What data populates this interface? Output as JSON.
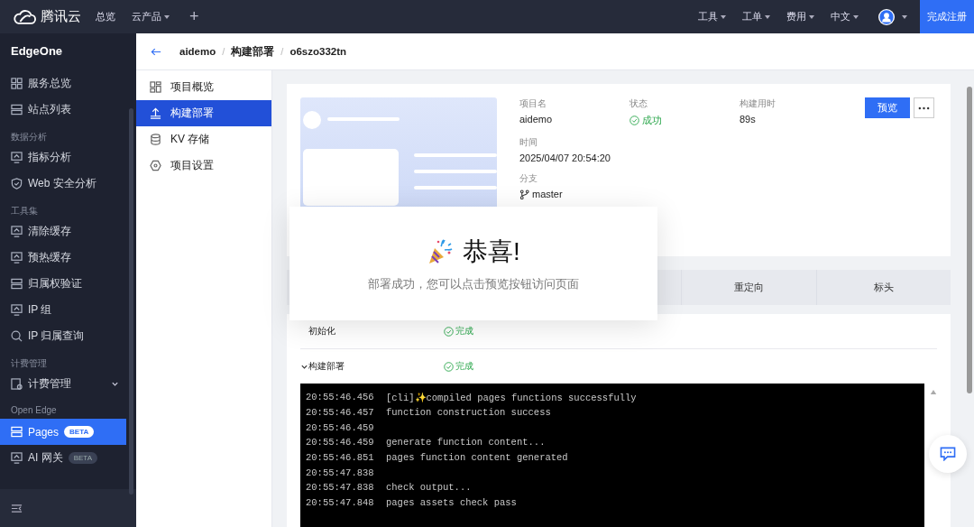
{
  "topbar": {
    "brand": "腾讯云",
    "nav": [
      {
        "label": "总览",
        "dropdown": false
      },
      {
        "label": "云产品",
        "dropdown": true
      }
    ],
    "add": "+",
    "menus": [
      {
        "label": "工具"
      },
      {
        "label": "工单"
      },
      {
        "label": "费用"
      },
      {
        "label": "中文"
      }
    ],
    "register": "完成注册"
  },
  "sidebar": {
    "title": "EdgeOne",
    "groups": [
      {
        "items": [
          {
            "label": "服务总览",
            "selected": false
          },
          {
            "label": "站点列表",
            "selected": false
          }
        ]
      },
      {
        "heading": "数据分析",
        "items": [
          {
            "label": "指标分析",
            "selected": false
          },
          {
            "label": "Web 安全分析",
            "selected": false
          }
        ]
      },
      {
        "heading": "工具集",
        "items": [
          {
            "label": "清除缓存",
            "selected": false
          },
          {
            "label": "预热缓存",
            "selected": false
          },
          {
            "label": "归属权验证",
            "selected": false
          },
          {
            "label": "IP 组",
            "selected": false
          },
          {
            "label": "IP 归属查询",
            "selected": false
          }
        ]
      },
      {
        "heading": "计费管理",
        "items": [
          {
            "label": "计费管理",
            "selected": false,
            "expandable": true
          }
        ]
      },
      {
        "heading": "Open Edge",
        "items": [
          {
            "label": "Pages",
            "selected": true,
            "badge": "BETA"
          },
          {
            "label": "AI 网关",
            "selected": false,
            "badge": "BETA"
          }
        ]
      }
    ]
  },
  "breadcrumb": {
    "separator": "/",
    "items": [
      "aidemo",
      "构建部署",
      "o6szo332tn"
    ]
  },
  "subnav": [
    {
      "label": "项目概览",
      "selected": false
    },
    {
      "label": "构建部署",
      "selected": true
    },
    {
      "label": "KV 存储",
      "selected": false
    },
    {
      "label": "项目设置",
      "selected": false
    }
  ],
  "deployment": {
    "field_rows": [
      [
        {
          "label": "项目名",
          "value": "aidemo",
          "kind": "text"
        },
        {
          "label": "状态",
          "value": "成功",
          "kind": "status"
        },
        {
          "label": "构建用时",
          "value": "89s",
          "kind": "text"
        }
      ],
      [
        {
          "label": "时间",
          "value": "2025/04/07 20:54:20",
          "kind": "text"
        }
      ],
      [
        {
          "label": "分支",
          "value": "master",
          "kind": "branch"
        }
      ]
    ],
    "preview_button": "预览"
  },
  "tabs": [
    {
      "label": "重定向",
      "selected": false
    },
    {
      "label": "标头",
      "selected": false
    }
  ],
  "steps": [
    {
      "label": "初始化",
      "status": "完成",
      "expanded": false,
      "done": true
    },
    {
      "label": "构建部署",
      "status": "完成",
      "expanded": true,
      "done": true
    }
  ],
  "log": [
    {
      "time": "20:55:46.456",
      "text": "[cli]✨compiled pages functions successfully"
    },
    {
      "time": "20:55:46.457",
      "text": "function construction success"
    },
    {
      "time": "20:55:46.459"
    },
    {
      "time": "20:55:46.459",
      "text": "generate function content..."
    },
    {
      "time": "20:55:46.851",
      "text": "pages function content generated"
    },
    {
      "time": "20:55:47.838"
    },
    {
      "time": "20:55:47.838",
      "text": "check output..."
    },
    {
      "time": "20:55:47.848",
      "text": "pages assets check pass"
    }
  ],
  "dialog": {
    "title": "恭喜!",
    "message": "部署成功，您可以点击预览按钮访问页面"
  }
}
